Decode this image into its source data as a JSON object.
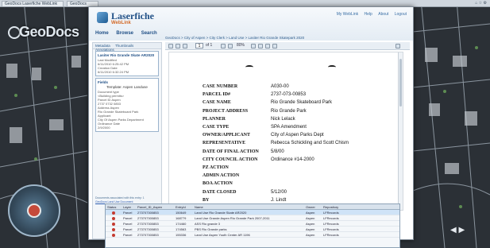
{
  "browser": {
    "tabs": [
      "GeoDocs Laserfiche WebLink",
      "GeoDocs"
    ],
    "icons": [
      "home-icon",
      "star-icon",
      "settings-icon"
    ]
  },
  "geodocs": {
    "logo_text": "GeoDocs"
  },
  "laserfiche": {
    "brand": "Laserfiche",
    "sub": "WebLink",
    "top_links": [
      "My WebLink",
      "Help",
      "About",
      "Logout"
    ],
    "nav": [
      "Home",
      "Browse",
      "Search"
    ],
    "breadcrumb": "GeoDocs > City of Aspen > City Clerk > Land Use > Lasiter Rio Grande Skatepark 2020",
    "left_tabs": [
      "Metadata",
      "Thumbnails",
      "Annotations"
    ],
    "entry_box": {
      "title": "Lasiter Rio Grande Skate AR2020",
      "lines": [
        "Last Modified",
        "6/11/2010 6:25:42 PM",
        "Creation Date",
        "6/11/2010 6:32:24 PM"
      ]
    },
    "template_box": {
      "title": "Fields",
      "center": "Template: Aspen Landuse",
      "lines": [
        "Document type",
        "<Building permits>",
        "Parcel ID Aspen",
        "2737 0732 0853",
        "Address Aspen",
        "Rio Grande Skateboard Park",
        "Applicant",
        "City Of Aspen Parks Department",
        "Ordinance Date",
        "2/9/2000"
      ]
    },
    "left_footer": "Documents associated with this entry: 1",
    "left_footer_link": "GeoDocs Land Use Document",
    "toolbar": {
      "page": "1",
      "page_total": "of 1",
      "zoom": "80%"
    }
  },
  "document": {
    "fields": [
      {
        "label": "CASE NUMBER",
        "value": "A030-00"
      },
      {
        "label": "PARCEL ID#",
        "value": "2737-073-00853"
      },
      {
        "label": "CASE NAME",
        "value": "Rio Grande Skateboard Park"
      },
      {
        "label": "PROJECT ADDRESS",
        "value": "Rio Grande Park"
      },
      {
        "label": "PLANNER",
        "value": "Nick Lelack"
      },
      {
        "label": "CASE TYPE",
        "value": "SPA Amendment"
      },
      {
        "label": "OWNER/APPLICANT",
        "value": "City of Aspen Parks Dept"
      },
      {
        "label": "REPRESENTATIVE",
        "value": "Rebecca Schickling and Scott Chism"
      },
      {
        "label": "DATE OF FINAL ACTION",
        "value": "5/8/00"
      },
      {
        "label": "CITY COUNCIL ACTION",
        "value": "Ordinance #14-2000"
      },
      {
        "label": "PZ ACTION",
        "value": ""
      },
      {
        "label": "ADMIN ACTION",
        "value": ""
      },
      {
        "label": "BOA ACTION",
        "value": ""
      },
      {
        "label": "DATE CLOSED",
        "value": "5/12/00"
      },
      {
        "label": "BY",
        "value": "J. Lindt"
      }
    ]
  },
  "results": {
    "columns": [
      "Status",
      "Layer",
      "Parcel_ID_Aspen",
      "EntryId",
      "Name",
      "Owner",
      "Repository"
    ],
    "rows": [
      [
        "Parcel",
        "273707300853",
        "150649",
        "Land Use Rio Grande Skate AR2020",
        "Aspen",
        "LFRecords"
      ],
      [
        "Parcel",
        "273707300853",
        "168779",
        "Land Use Grande Aspen Rio Grande Park 2007-2011",
        "Aspen",
        "LFRecords"
      ],
      [
        "Parcel",
        "273707300853",
        "174460",
        "ASS Rio grande 3",
        "Aspen",
        "LFRecords"
      ],
      [
        "Parcel",
        "273707300853",
        "174563",
        "PBS Rio Grande parks",
        "Aspen",
        "LFRecords"
      ],
      [
        "Parcel",
        "273707300853",
        "155336",
        "Land Use Aspen Youth Center AR 1196",
        "Aspen",
        "LFRecords"
      ]
    ]
  },
  "colors": {
    "accent": "#1f4f86",
    "orange": "#d36b2a",
    "map_bg": "#2b3036",
    "status_red": "#c43a2f"
  }
}
